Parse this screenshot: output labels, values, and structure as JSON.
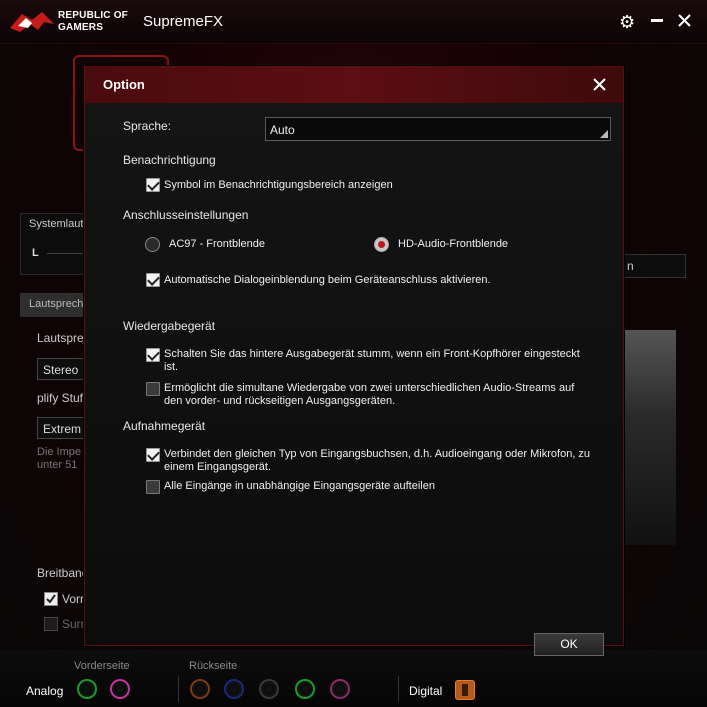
{
  "app": {
    "brand_line1": "REPUBLIC OF",
    "brand_line2": "GAMERS",
    "title": "SupremeFX",
    "settings_icon": "gear-icon",
    "minimize_icon": "minimize-icon",
    "close_icon": "close-icon",
    "accent_color": "#8a1212"
  },
  "background": {
    "system_volume_label": "Systemlaut",
    "channel_l": "L",
    "tab_speaker": "Lautsprech",
    "speaker_label": "Lautspre",
    "speaker_select_value": "Stereo",
    "amplify_label": "plify Stuf",
    "amplify_select_value": "Extrem",
    "note_line1": "Die Impe",
    "note_line2": "unter 51",
    "right_box_text": "n",
    "broadband_label": "Breitband",
    "bg_checkbox1_label": "Vorr",
    "bg_checkbox2_label": "Surr"
  },
  "bottom_bar": {
    "front_label": "Vorderseite",
    "rear_label": "Rückseite",
    "analog_label": "Analog",
    "digital_label": "Digital",
    "front_jacks": [
      {
        "name": "front-jack-green",
        "color": "#1a9a2a"
      },
      {
        "name": "front-jack-pink",
        "color": "#c0369a"
      }
    ],
    "rear_jacks": [
      {
        "name": "rear-jack-orange",
        "color": "#7a3a1a"
      },
      {
        "name": "rear-jack-blue",
        "color": "#1a2a7a"
      },
      {
        "name": "rear-jack-black",
        "color": "#2a2a2a"
      },
      {
        "name": "rear-jack-green",
        "color": "#1a9a2a"
      },
      {
        "name": "rear-jack-pink",
        "color": "#8a2a6a"
      }
    ]
  },
  "dialog": {
    "title": "Option",
    "language_label": "Sprache:",
    "language_value": "Auto",
    "notification_heading": "Benachrichtigung",
    "notification_option": "Symbol im Benachrichtigungsbereich anzeigen",
    "notification_checked": true,
    "connection_heading": "Anschlusseinstellungen",
    "radio_ac97": "AC97 - Frontblende",
    "radio_hd": "HD-Audio-Frontblende",
    "radio_selected": "hd",
    "auto_popup_option": "Automatische Dialogeinblendung beim Geräteanschluss aktivieren.",
    "auto_popup_checked": true,
    "playback_heading": "Wiedergabegerät",
    "playback_opt1_line1": "Schalten Sie das hintere Ausgabegerät stumm, wenn ein Front-Kopfhörer eingesteckt",
    "playback_opt1_line2": "ist.",
    "playback_opt1_checked": true,
    "playback_opt2_line1": "Ermöglicht die simultane Wiedergabe von zwei unterschiedlichen Audio-Streams auf",
    "playback_opt2_line2": "den vorder- und rückseitigen Ausgangsgeräten.",
    "playback_opt2_checked": false,
    "recording_heading": "Aufnahmegerät",
    "recording_opt1_line1": "Verbindet den gleichen Typ von Eingangsbuchsen, d.h. Audioeingang oder Mikrofon, zu",
    "recording_opt1_line2": "einem Eingangsgerät.",
    "recording_opt1_checked": true,
    "recording_opt2": "Alle Eingänge in unabhängige Eingangsgeräte aufteilen",
    "recording_opt2_checked": false,
    "ok_label": "OK"
  }
}
